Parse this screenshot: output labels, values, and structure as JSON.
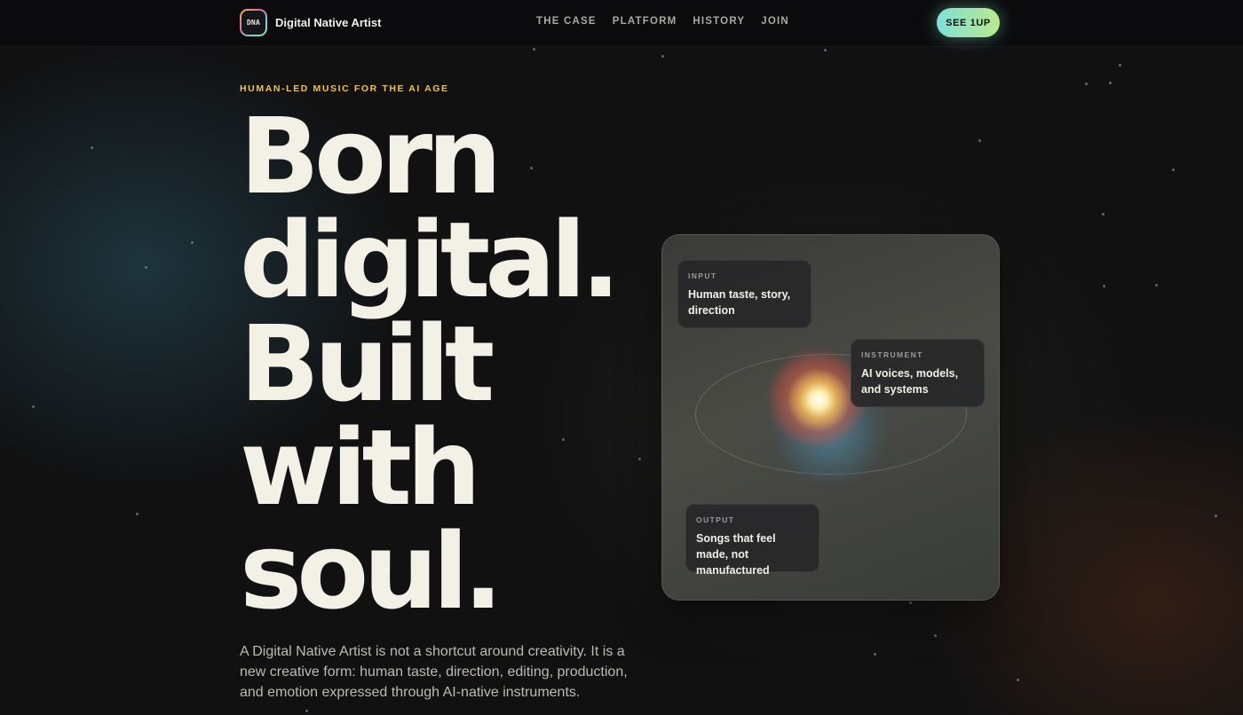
{
  "nav": {
    "logo_mark": "DNA",
    "brand_name": "Digital Native Artist",
    "links": [
      "THE CASE",
      "PLATFORM",
      "HISTORY",
      "JOIN"
    ],
    "cta_label": "SEE 1UP"
  },
  "hero": {
    "eyebrow": "HUMAN-LED MUSIC FOR THE AI AGE",
    "headline_lines": [
      "Born",
      "digital.",
      "Built",
      "with",
      "soul."
    ],
    "lede": "A Digital Native Artist is not a shortcut around creativity. It is a new creative form: human taste, direction, editing, production, and emotion expressed through AI-native instruments."
  },
  "card": {
    "input": {
      "label": "INPUT",
      "text": "Human taste, story, direction"
    },
    "instrument": {
      "label": "INSTRUMENT",
      "text": "AI voices, models, and systems"
    },
    "output": {
      "label": "OUTPUT",
      "text": "Songs that feel made, not manufactured"
    }
  },
  "colors": {
    "accent_gold": "#f0c24e",
    "cta_gradient_start": "#7fe0d8",
    "cta_gradient_end": "#b9e98c",
    "headline": "#f3f0e6"
  }
}
